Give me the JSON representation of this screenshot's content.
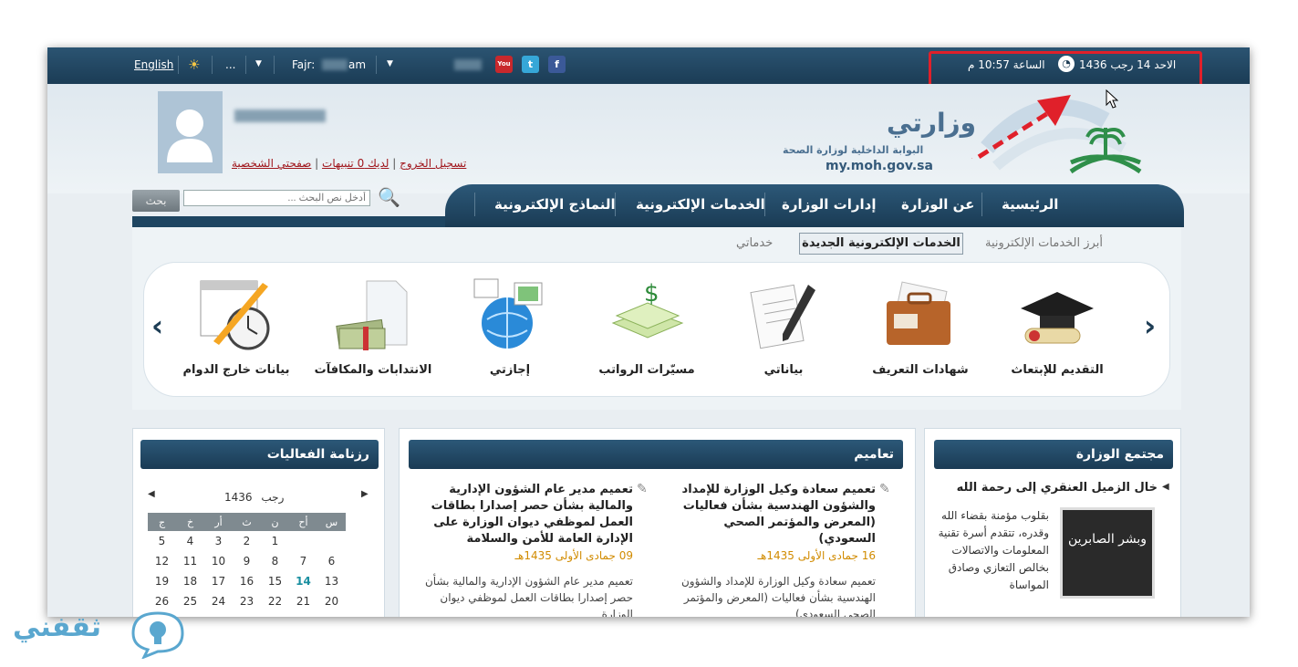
{
  "topbar": {
    "language_link": "English",
    "ellipsis": "...",
    "prayer_label": "Fajr:",
    "prayer_suffix": "am",
    "date_text": "الاحد 14 رجب 1436",
    "time_text": "الساعة 10:57 م"
  },
  "user": {
    "profile_link": "صفحتي الشخصية",
    "notifications_link": "لديك 0 تنبيهات",
    "logout_link": "تسجيل الخروج"
  },
  "logo": {
    "title": "وزارتي",
    "subtitle": "البوابة الداخلية لوزارة الصحة",
    "url": "my.moh.gov.sa"
  },
  "nav": {
    "items": [
      "الرئيسية",
      "عن الوزارة",
      "إدارات الوزارة",
      "الخدمات الإلكترونية",
      "النماذج الإلكترونية"
    ]
  },
  "search": {
    "placeholder": "أدخل نص البحث ...",
    "button": "بحث"
  },
  "services": {
    "tabs": [
      "أبرز الخدمات الإلكترونية",
      "الخدمات الإلكترونية الجديدة",
      "خدماتي"
    ],
    "items": [
      "التقديم للإبتعاث",
      "شهادات التعريف",
      "بياناتي",
      "مسيّرات الرواتب",
      "إجازتي",
      "الانتدابات والمكافآت",
      "بيانات خارج الدوام"
    ]
  },
  "community": {
    "title": "مجتمع الوزارة",
    "headline": "خال الزميل العنقري إلى رحمة الله",
    "body": "بقلوب مؤمنة بقضاء الله وقدره، تتقدم أسرة تقنية المعلومات والاتصالات بخالص التعازي وصادق المواساة",
    "image_caption": "وبشر الصابرين"
  },
  "circulars": {
    "title": "تعاميم",
    "items": [
      {
        "title": "تعميم سعادة وكيل الوزارة للإمداد والشؤون الهندسية بشأن فعاليات (المعرض والمؤتمر الصحي السعودي)",
        "date": "16 جمادى الأولى 1435هـ",
        "summary": "تعميم سعادة وكيل الوزارة للإمداد والشؤون الهندسية بشأن فعاليات (المعرض والمؤتمر الصحي السعودي)"
      },
      {
        "title": "تعميم مدير عام الشؤون الإدارية والمالية بشأن حصر إصدارا بطاقات العمل لموظفي ديوان الوزارة على الإدارة العامة للأمن والسلامة",
        "date": "09 جمادى الأولى 1435هـ",
        "summary": "تعميم مدير عام الشؤون الإدارية والمالية بشأن حصر إصدارا بطاقات العمل لموظفي ديوان الوزارة"
      }
    ]
  },
  "calendar": {
    "title": "رزنامة الفعاليات",
    "month": "رجب",
    "year": "1436",
    "weekdays": [
      "س",
      "أح",
      "ن",
      "ث",
      "أر",
      "خ",
      "ج"
    ],
    "rows": [
      [
        "",
        "",
        "1",
        "2",
        "3",
        "4",
        "5"
      ],
      [
        "6",
        "7",
        "8",
        "9",
        "10",
        "11",
        "12"
      ],
      [
        "13",
        "14",
        "15",
        "16",
        "17",
        "18",
        "19"
      ],
      [
        "20",
        "21",
        "22",
        "23",
        "24",
        "25",
        "26"
      ]
    ],
    "today": "14"
  },
  "watermark": "ثقفني",
  "colors": {
    "nav": "#1e4561",
    "highlight": "#e0202a",
    "date": "#d18b00",
    "today": "#1a8fa0"
  }
}
